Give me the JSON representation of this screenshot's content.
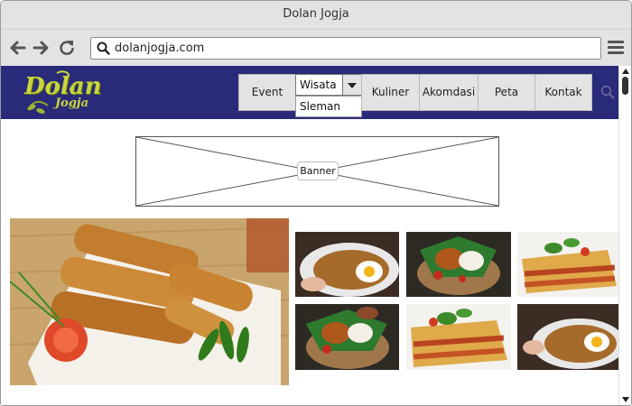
{
  "browser": {
    "window_title": "Dolan Jogja",
    "url": "dolanjogja.com"
  },
  "site": {
    "logo_text_main": "Dolan",
    "logo_text_sub": "Jogja",
    "nav": {
      "event": "Event",
      "wisata": "Wisata",
      "wisata_option": "Sleman",
      "kuliner": "Kuliner",
      "akomodasi": "Akomdasi",
      "peta": "Peta",
      "kontak": "Kontak"
    },
    "banner_label": "Banner",
    "photos": [
      "spring-rolls-photo",
      "nasi-goreng-egg-photo",
      "fried-chicken-rice-photo",
      "lasagna-photo",
      "fried-chicken-rice-photo",
      "lasagna-photo",
      "nasi-goreng-egg-photo"
    ]
  },
  "colors": {
    "header_bg": "#2a2a7a",
    "nav_bg": "#e3e3e3",
    "chrome_bg": "#e3e3e3"
  }
}
